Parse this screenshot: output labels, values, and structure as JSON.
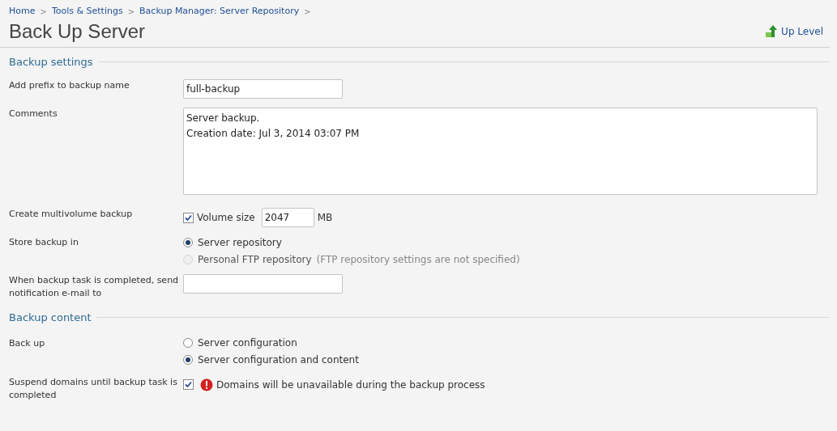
{
  "breadcrumbs": [
    "Home",
    "Tools & Settings",
    "Backup Manager: Server Repository"
  ],
  "breadcrumb_separator": ">",
  "title": "Back Up Server",
  "up_level": "Up Level",
  "sections": [
    {
      "heading": "Backup settings",
      "rows": [
        {
          "kind": "text",
          "label": "Add prefix to backup name",
          "value": "full-backup"
        },
        {
          "kind": "textarea",
          "label": "Comments",
          "value": "Server backup.\nCreation date: Jul 3, 2014 03:07 PM"
        },
        {
          "kind": "volume",
          "label": "Create multivolume backup",
          "checked": true,
          "check_label": "Volume size",
          "value": "2047",
          "unit": "MB"
        },
        {
          "kind": "radio",
          "label": "Store backup in",
          "options": [
            {
              "label": "Server repository",
              "selected": true,
              "disabled": false
            },
            {
              "label": "Personal FTP repository",
              "note": "(FTP repository settings are not specified)",
              "selected": false,
              "disabled": true
            }
          ]
        },
        {
          "kind": "text",
          "label": "When backup task is completed, send notification e-mail to",
          "value": ""
        }
      ]
    },
    {
      "heading": "Backup content",
      "rows": [
        {
          "kind": "radio",
          "label": "Back up",
          "options": [
            {
              "label": "Server configuration",
              "selected": false,
              "disabled": false
            },
            {
              "label": "Server configuration and content",
              "selected": true,
              "disabled": false
            }
          ]
        },
        {
          "kind": "warning",
          "label": "Suspend domains until backup task is completed",
          "checked": true,
          "message": "Domains will be unavailable during the backup process"
        }
      ]
    }
  ]
}
